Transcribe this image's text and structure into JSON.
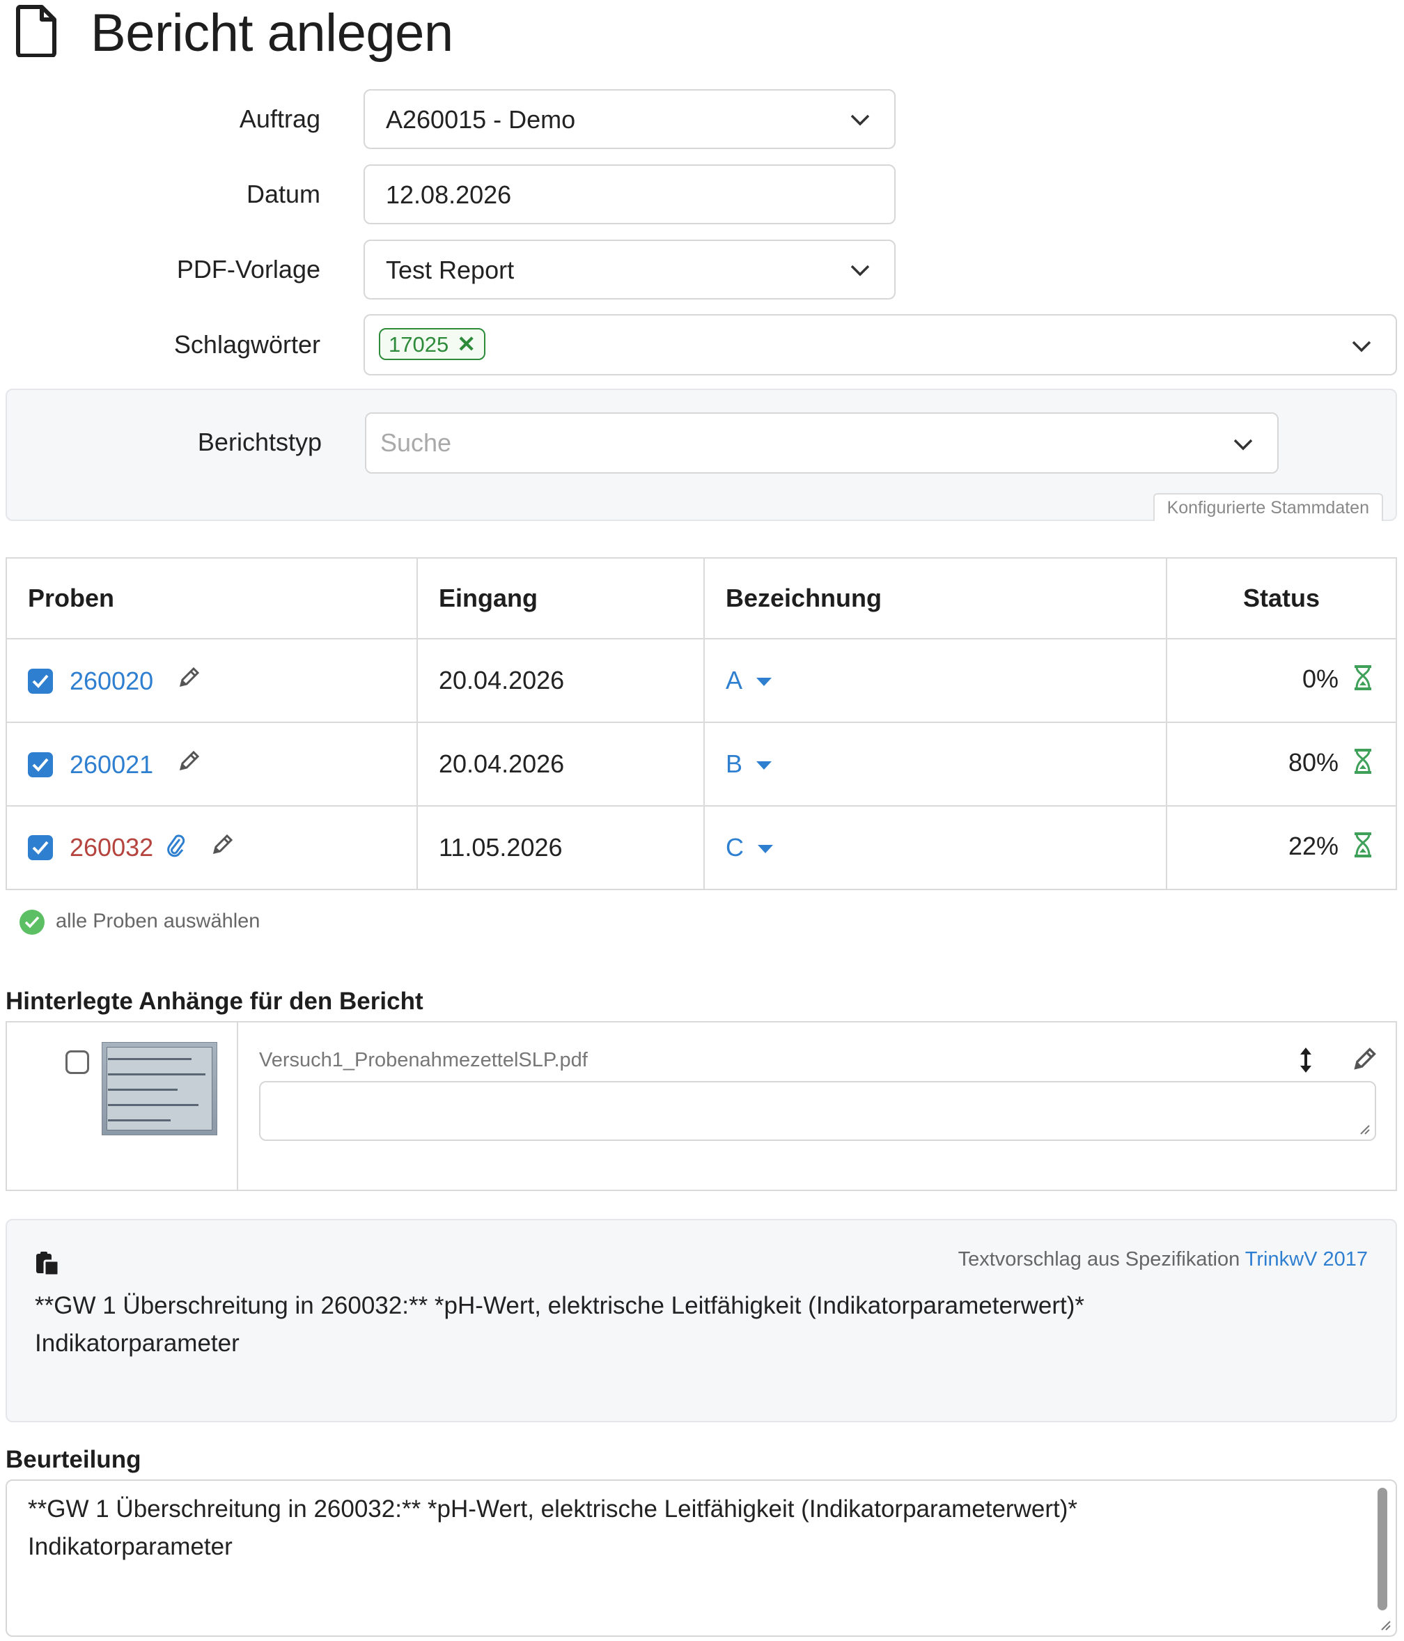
{
  "page": {
    "title": "Bericht anlegen"
  },
  "form": {
    "auftrag": {
      "label": "Auftrag",
      "value": "A260015 - Demo"
    },
    "datum": {
      "label": "Datum",
      "value": "12.08.2026"
    },
    "pdf_vorlage": {
      "label": "PDF-Vorlage",
      "value": "Test Report"
    },
    "schlagwoerter": {
      "label": "Schlagwörter",
      "tags": [
        "17025"
      ]
    },
    "berichtstyp": {
      "label": "Berichtstyp",
      "placeholder": "Suche",
      "badge": "Konfigurierte Stammdaten"
    }
  },
  "table": {
    "headers": [
      "Proben",
      "Eingang",
      "Bezeichnung",
      "Status"
    ],
    "rows": [
      {
        "id": "260020",
        "eingang": "20.04.2026",
        "bezeichnung": "A",
        "status": "0%",
        "has_attachment": false,
        "id_color": "#2f7fd1"
      },
      {
        "id": "260021",
        "eingang": "20.04.2026",
        "bezeichnung": "B",
        "status": "80%",
        "has_attachment": false,
        "id_color": "#2f7fd1"
      },
      {
        "id": "260032",
        "eingang": "11.05.2026",
        "bezeichnung": "C",
        "status": "22%",
        "has_attachment": true,
        "id_color": "#b5443f"
      }
    ],
    "select_all_label": "alle Proben auswählen"
  },
  "attachments": {
    "title": "Hinterlegte Anhänge für den Bericht",
    "items": [
      {
        "filename": "Versuch1_ProbenahmezettelSLP.pdf",
        "checked": false
      }
    ]
  },
  "suggestion": {
    "source_prefix": "Textvorschlag aus Spezifikation",
    "source_link": "TrinkwV 2017",
    "line1": "**GW 1 Überschreitung in 260032:** *pH-Wert, elektrische Leitfähigkeit (Indikatorparameterwert)*",
    "line2": "Indikatorparameter"
  },
  "beurteilung": {
    "label": "Beurteilung",
    "line1": "**GW 1 Überschreitung in 260032:** *pH-Wert, elektrische Leitfähigkeit (Indikatorparameterwert)*",
    "line2": "Indikatorparameter"
  },
  "colors": {
    "accent": "#2f7fd1",
    "success": "#5cbf63",
    "tag": "#2e8b3a",
    "hourglass": "#3fa05a"
  }
}
